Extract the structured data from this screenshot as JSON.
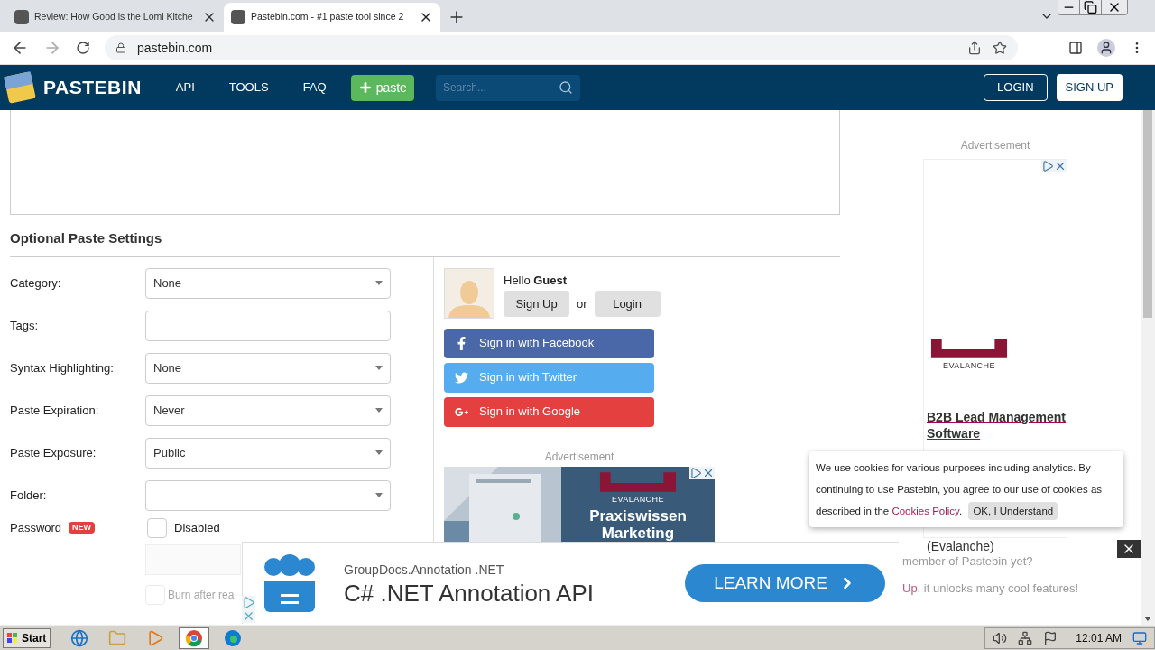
{
  "browser": {
    "tabs": [
      {
        "title": "Review: How Good is the Lomi Kitche",
        "selected": false
      },
      {
        "title": "Pastebin.com - #1 paste tool since 2",
        "selected": true
      }
    ],
    "url": "pastebin.com"
  },
  "nav": {
    "logo": "PASTEBIN",
    "links": [
      "API",
      "TOOLS",
      "FAQ"
    ],
    "paste_button": "paste",
    "search_placeholder": "Search...",
    "login": "LOGIN",
    "signup": "SIGN UP"
  },
  "settings": {
    "title": "Optional Paste Settings",
    "fields": [
      {
        "label": "Category:",
        "kind": "select",
        "value": "None"
      },
      {
        "label": "Tags:",
        "kind": "text"
      },
      {
        "label": "Syntax Highlighting:",
        "kind": "select",
        "value": "None"
      },
      {
        "label": "Paste Expiration:",
        "kind": "select",
        "value": "Never"
      },
      {
        "label": "Paste Exposure:",
        "kind": "select",
        "value": "Public"
      },
      {
        "label": "Folder:",
        "kind": "select"
      }
    ],
    "password": {
      "label": "Password",
      "badge": "NEW",
      "option": "Disabled",
      "checked": false
    },
    "burn": {
      "label": "Burn after rea",
      "checked": false,
      "disabled": true
    }
  },
  "user": {
    "greeting": "Hello",
    "name": "Guest",
    "signup": "Sign Up",
    "or": "or",
    "login": "Login",
    "social": [
      {
        "kind": "facebook",
        "label": "Sign in with Facebook"
      },
      {
        "kind": "twitter",
        "label": "Sign in with Twitter"
      },
      {
        "kind": "google",
        "label": "Sign in with Google"
      }
    ]
  },
  "mid_ad": {
    "label": "Advertisement",
    "brand": "EVALANCHE",
    "lines": [
      "Praxiswissen",
      "Marketing"
    ]
  },
  "side_ad": {
    "label": "Advertisement",
    "brand": "EVALANCHE",
    "link": "B2B Lead Management Software",
    "footer": "(Evalanche)"
  },
  "faded": {
    "line1": "member of Pastebin yet?",
    "link": "Up.",
    "line2": "it unlocks many cool features!"
  },
  "cookie": {
    "text": "We use cookies for various purposes including analytics. By continuing to use Pastebin, you agree to our use of cookies as described in the",
    "link": "Cookies Policy",
    "after": ".",
    "button": "OK, I Understand"
  },
  "bottom_ad": {
    "brand": "GroupDocs.Annotation .NET",
    "title": "C# .NET Annotation API",
    "button": "LEARN MORE"
  },
  "taskbar": {
    "start": "Start",
    "time": "12:01 AM",
    "apps": [
      {
        "kind": "ie",
        "selected": false
      },
      {
        "kind": "folder",
        "selected": false
      },
      {
        "kind": "media",
        "selected": false
      },
      {
        "kind": "chrome",
        "selected": true
      },
      {
        "kind": "edge",
        "selected": false
      }
    ]
  }
}
